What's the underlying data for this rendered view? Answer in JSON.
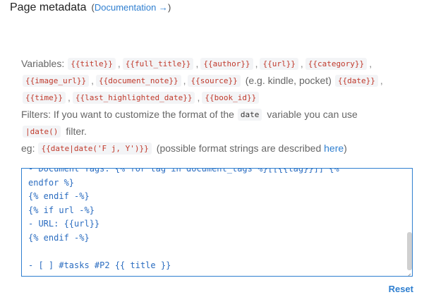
{
  "header": {
    "title": "Page metadata",
    "doc_open": "(",
    "doc_link": "Documentation →",
    "doc_close": ")"
  },
  "help": {
    "variables_label": "Variables:",
    "variables": [
      "{{title}}",
      "{{full_title}}",
      "{{author}}",
      "{{url}}",
      "{{category}}",
      "{{image_url}}",
      "{{document_note}}",
      "{{source}}",
      "{{date}}",
      "{{time}}",
      "{{last_highlighted_date}}",
      "{{book_id}}"
    ],
    "source_note": "(e.g. kindle, pocket)",
    "filters_text": "Filters: If you want to customize the format of the",
    "filters_var": "date",
    "filters_text2": "variable you can use",
    "filter_code": "|date()",
    "filter_word": "filter.",
    "eg_label": "eg:",
    "eg_code": "{{date|date('F j, Y')}}",
    "eg_text": "(possible format strings are described",
    "here_link": "here",
    "eg_close": ")"
  },
  "editor": {
    "lines": [
      "- Document Tags: {% for tag in document_tags %}[[{{tag}}]] {%",
      "endfor %}",
      "{% endif -%}",
      "{% if url -%}",
      "- URL: {{url}}",
      "{% endif -%}",
      "",
      "- [ ] #tasks #P2 {{ title }}"
    ]
  },
  "footer": {
    "reset_label": "Reset"
  }
}
